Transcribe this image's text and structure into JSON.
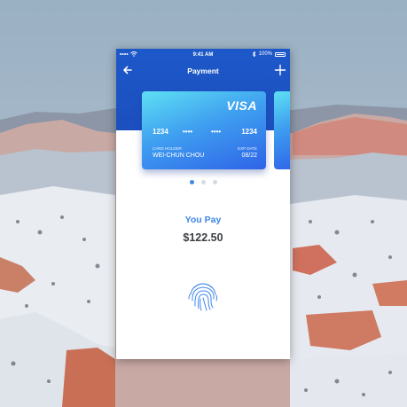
{
  "status_bar": {
    "time": "9:41 AM",
    "battery": "100%"
  },
  "nav": {
    "title": "Payment",
    "back_icon": "arrow-left-icon",
    "add_icon": "plus-icon"
  },
  "card": {
    "brand": "VISA",
    "number_groups": [
      "1234",
      "••••",
      "••••",
      "1234"
    ],
    "holder_label": "CARD HOLDER",
    "holder_name": "WEI-CHUN CHOU",
    "exp_label": "EXP DATE",
    "exp_value": "08/22"
  },
  "pager": {
    "count": 3,
    "active_index": 0
  },
  "payment": {
    "label": "You Pay",
    "amount": "$122.50"
  },
  "colors": {
    "header": "#1d58c9",
    "accent": "#3f86ea",
    "card_start": "#5ee0f4",
    "card_end": "#2e63e8"
  }
}
